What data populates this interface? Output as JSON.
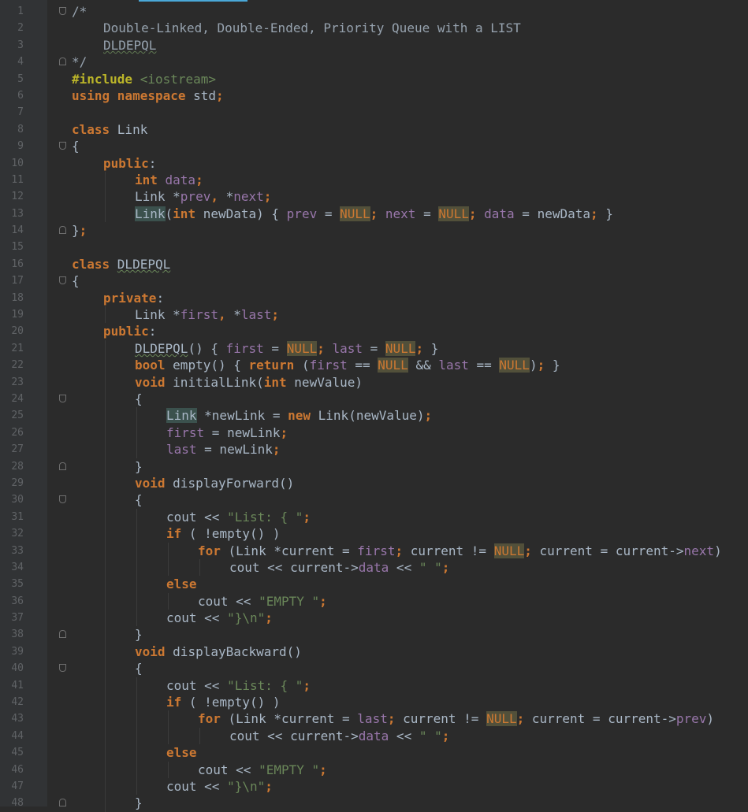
{
  "lines": [
    {
      "n": "1",
      "fold": "open",
      "indent": 0,
      "t": [
        {
          "c": "cm",
          "v": "/*"
        }
      ]
    },
    {
      "n": "2",
      "indent": 1,
      "t": [
        {
          "c": "cm",
          "v": "Double-Linked, Double-Ended, Priority Queue with a LIST"
        }
      ]
    },
    {
      "n": "3",
      "indent": 1,
      "t": [
        {
          "c": "cm squig",
          "v": "DLDEPQL"
        }
      ]
    },
    {
      "n": "4",
      "fold": "close",
      "indent": 0,
      "t": [
        {
          "c": "cm",
          "v": "*/"
        }
      ]
    },
    {
      "n": "5",
      "indent": 0,
      "t": [
        {
          "c": "pp kw",
          "v": "#include "
        },
        {
          "c": "str",
          "v": "<iostream>"
        }
      ]
    },
    {
      "n": "6",
      "indent": 0,
      "t": [
        {
          "c": "kw",
          "v": "using namespace "
        },
        {
          "c": "plain",
          "v": "std"
        },
        {
          "c": "kw",
          "v": ";"
        }
      ]
    },
    {
      "n": "7",
      "indent": 0,
      "t": []
    },
    {
      "n": "8",
      "indent": 0,
      "t": [
        {
          "c": "kw",
          "v": "class "
        },
        {
          "c": "plain",
          "v": "Link"
        }
      ]
    },
    {
      "n": "9",
      "fold": "open",
      "indent": 0,
      "t": [
        {
          "c": "plain",
          "v": "{"
        }
      ]
    },
    {
      "n": "10",
      "indent": 1,
      "t": [
        {
          "c": "kw",
          "v": "public"
        },
        {
          "c": "plain",
          "v": ":"
        }
      ]
    },
    {
      "n": "11",
      "indent": 2,
      "t": [
        {
          "c": "kw",
          "v": "int "
        },
        {
          "c": "fld",
          "v": "data"
        },
        {
          "c": "kw",
          "v": ";"
        }
      ]
    },
    {
      "n": "12",
      "indent": 2,
      "t": [
        {
          "c": "plain",
          "v": "Link *"
        },
        {
          "c": "fld",
          "v": "prev"
        },
        {
          "c": "kw",
          "v": ", "
        },
        {
          "c": "plain",
          "v": "*"
        },
        {
          "c": "fld",
          "v": "next"
        },
        {
          "c": "kw",
          "v": ";"
        }
      ]
    },
    {
      "n": "13",
      "indent": 2,
      "t": [
        {
          "c": "plain hl",
          "v": "Link"
        },
        {
          "c": "plain",
          "v": "("
        },
        {
          "c": "kw",
          "v": "int "
        },
        {
          "c": "plain",
          "v": "newData) { "
        },
        {
          "c": "fld",
          "v": "prev"
        },
        {
          "c": "plain",
          "v": " = "
        },
        {
          "c": "nul",
          "v": "NULL"
        },
        {
          "c": "kw",
          "v": "; "
        },
        {
          "c": "fld",
          "v": "next"
        },
        {
          "c": "plain",
          "v": " = "
        },
        {
          "c": "nul",
          "v": "NULL"
        },
        {
          "c": "kw",
          "v": "; "
        },
        {
          "c": "fld",
          "v": "data"
        },
        {
          "c": "plain",
          "v": " = newData"
        },
        {
          "c": "kw",
          "v": "; "
        },
        {
          "c": "plain",
          "v": "}"
        }
      ]
    },
    {
      "n": "14",
      "fold": "close",
      "indent": 0,
      "t": [
        {
          "c": "plain",
          "v": "}"
        },
        {
          "c": "kw",
          "v": ";"
        }
      ]
    },
    {
      "n": "15",
      "indent": 0,
      "t": []
    },
    {
      "n": "16",
      "indent": 0,
      "t": [
        {
          "c": "kw",
          "v": "class "
        },
        {
          "c": "plain squig",
          "v": "DLDEPQL"
        }
      ]
    },
    {
      "n": "17",
      "fold": "open",
      "indent": 0,
      "t": [
        {
          "c": "plain",
          "v": "{"
        }
      ]
    },
    {
      "n": "18",
      "indent": 1,
      "t": [
        {
          "c": "kw",
          "v": "private"
        },
        {
          "c": "plain",
          "v": ":"
        }
      ]
    },
    {
      "n": "19",
      "indent": 2,
      "t": [
        {
          "c": "plain",
          "v": "Link *"
        },
        {
          "c": "fld",
          "v": "first"
        },
        {
          "c": "kw",
          "v": ", "
        },
        {
          "c": "plain",
          "v": "*"
        },
        {
          "c": "fld",
          "v": "last"
        },
        {
          "c": "kw",
          "v": ";"
        }
      ]
    },
    {
      "n": "20",
      "indent": 1,
      "t": [
        {
          "c": "kw",
          "v": "public"
        },
        {
          "c": "plain",
          "v": ":"
        }
      ]
    },
    {
      "n": "21",
      "indent": 2,
      "t": [
        {
          "c": "plain squig",
          "v": "DLDEPQL"
        },
        {
          "c": "plain",
          "v": "() { "
        },
        {
          "c": "fld",
          "v": "first"
        },
        {
          "c": "plain",
          "v": " = "
        },
        {
          "c": "nul",
          "v": "NULL"
        },
        {
          "c": "kw",
          "v": "; "
        },
        {
          "c": "fld",
          "v": "last"
        },
        {
          "c": "plain",
          "v": " = "
        },
        {
          "c": "nul",
          "v": "NULL"
        },
        {
          "c": "kw",
          "v": "; "
        },
        {
          "c": "plain",
          "v": "}"
        }
      ]
    },
    {
      "n": "22",
      "indent": 2,
      "t": [
        {
          "c": "kw",
          "v": "bool "
        },
        {
          "c": "plain",
          "v": "empty() { "
        },
        {
          "c": "kw",
          "v": "return "
        },
        {
          "c": "plain",
          "v": "("
        },
        {
          "c": "fld",
          "v": "first"
        },
        {
          "c": "plain",
          "v": " == "
        },
        {
          "c": "nul",
          "v": "NULL"
        },
        {
          "c": "plain",
          "v": " && "
        },
        {
          "c": "fld",
          "v": "last"
        },
        {
          "c": "plain",
          "v": " == "
        },
        {
          "c": "nul",
          "v": "NULL"
        },
        {
          "c": "plain",
          "v": ")"
        },
        {
          "c": "kw",
          "v": "; "
        },
        {
          "c": "plain",
          "v": "}"
        }
      ]
    },
    {
      "n": "23",
      "indent": 2,
      "t": [
        {
          "c": "kw",
          "v": "void "
        },
        {
          "c": "plain",
          "v": "initialLink("
        },
        {
          "c": "kw",
          "v": "int "
        },
        {
          "c": "plain",
          "v": "newValue)"
        }
      ]
    },
    {
      "n": "24",
      "fold": "open",
      "indent": 2,
      "t": [
        {
          "c": "plain",
          "v": "{"
        }
      ]
    },
    {
      "n": "25",
      "indent": 3,
      "t": [
        {
          "c": "plain hl",
          "v": "Link"
        },
        {
          "c": "plain",
          "v": " *newLink = "
        },
        {
          "c": "kw",
          "v": "new "
        },
        {
          "c": "plain",
          "v": "Link(newValue)"
        },
        {
          "c": "kw",
          "v": ";"
        }
      ]
    },
    {
      "n": "26",
      "indent": 3,
      "t": [
        {
          "c": "fld",
          "v": "first"
        },
        {
          "c": "plain",
          "v": " = newLink"
        },
        {
          "c": "kw",
          "v": ";"
        }
      ]
    },
    {
      "n": "27",
      "indent": 3,
      "t": [
        {
          "c": "fld",
          "v": "last"
        },
        {
          "c": "plain",
          "v": " = newLink"
        },
        {
          "c": "kw",
          "v": ";"
        }
      ]
    },
    {
      "n": "28",
      "fold": "close",
      "indent": 2,
      "t": [
        {
          "c": "plain",
          "v": "}"
        }
      ]
    },
    {
      "n": "29",
      "indent": 2,
      "t": [
        {
          "c": "kw",
          "v": "void "
        },
        {
          "c": "plain",
          "v": "displayForward()"
        }
      ]
    },
    {
      "n": "30",
      "fold": "open",
      "indent": 2,
      "t": [
        {
          "c": "plain",
          "v": "{"
        }
      ]
    },
    {
      "n": "31",
      "indent": 3,
      "t": [
        {
          "c": "plain",
          "v": "cout << "
        },
        {
          "c": "str",
          "v": "\"List: { \""
        },
        {
          "c": "kw",
          "v": ";"
        }
      ]
    },
    {
      "n": "32",
      "indent": 3,
      "t": [
        {
          "c": "kw",
          "v": "if "
        },
        {
          "c": "plain",
          "v": "( !empty() )"
        }
      ]
    },
    {
      "n": "33",
      "indent": 4,
      "t": [
        {
          "c": "kw",
          "v": "for "
        },
        {
          "c": "plain",
          "v": "(Link *current = "
        },
        {
          "c": "fld",
          "v": "first"
        },
        {
          "c": "kw",
          "v": "; "
        },
        {
          "c": "plain",
          "v": "current != "
        },
        {
          "c": "nul",
          "v": "NULL"
        },
        {
          "c": "kw",
          "v": "; "
        },
        {
          "c": "plain",
          "v": "current = current->"
        },
        {
          "c": "fld",
          "v": "next"
        },
        {
          "c": "plain",
          "v": ")"
        }
      ]
    },
    {
      "n": "34",
      "indent": 5,
      "t": [
        {
          "c": "plain",
          "v": "cout << current->"
        },
        {
          "c": "fld",
          "v": "data"
        },
        {
          "c": "plain",
          "v": " << "
        },
        {
          "c": "str",
          "v": "\" \""
        },
        {
          "c": "kw",
          "v": ";"
        }
      ]
    },
    {
      "n": "35",
      "indent": 3,
      "t": [
        {
          "c": "kw",
          "v": "else"
        }
      ]
    },
    {
      "n": "36",
      "indent": 4,
      "t": [
        {
          "c": "plain",
          "v": "cout << "
        },
        {
          "c": "str",
          "v": "\"EMPTY \""
        },
        {
          "c": "kw",
          "v": ";"
        }
      ]
    },
    {
      "n": "37",
      "indent": 3,
      "t": [
        {
          "c": "plain",
          "v": "cout << "
        },
        {
          "c": "str",
          "v": "\"}\\n\""
        },
        {
          "c": "kw",
          "v": ";"
        }
      ]
    },
    {
      "n": "38",
      "fold": "close",
      "indent": 2,
      "t": [
        {
          "c": "plain",
          "v": "}"
        }
      ]
    },
    {
      "n": "39",
      "indent": 2,
      "t": [
        {
          "c": "kw",
          "v": "void "
        },
        {
          "c": "plain",
          "v": "displayBackward()"
        }
      ]
    },
    {
      "n": "40",
      "fold": "open",
      "indent": 2,
      "t": [
        {
          "c": "plain",
          "v": "{"
        }
      ]
    },
    {
      "n": "41",
      "indent": 3,
      "t": [
        {
          "c": "plain",
          "v": "cout << "
        },
        {
          "c": "str",
          "v": "\"List: { \""
        },
        {
          "c": "kw",
          "v": ";"
        }
      ]
    },
    {
      "n": "42",
      "indent": 3,
      "t": [
        {
          "c": "kw",
          "v": "if "
        },
        {
          "c": "plain",
          "v": "( !empty() )"
        }
      ]
    },
    {
      "n": "43",
      "indent": 4,
      "t": [
        {
          "c": "kw",
          "v": "for "
        },
        {
          "c": "plain",
          "v": "(Link *current = "
        },
        {
          "c": "fld",
          "v": "last"
        },
        {
          "c": "kw",
          "v": "; "
        },
        {
          "c": "plain",
          "v": "current != "
        },
        {
          "c": "nul",
          "v": "NULL"
        },
        {
          "c": "kw",
          "v": "; "
        },
        {
          "c": "plain",
          "v": "current = current->"
        },
        {
          "c": "fld",
          "v": "prev"
        },
        {
          "c": "plain",
          "v": ")"
        }
      ]
    },
    {
      "n": "44",
      "indent": 5,
      "t": [
        {
          "c": "plain",
          "v": "cout << current->"
        },
        {
          "c": "fld",
          "v": "data"
        },
        {
          "c": "plain",
          "v": " << "
        },
        {
          "c": "str",
          "v": "\" \""
        },
        {
          "c": "kw",
          "v": ";"
        }
      ]
    },
    {
      "n": "45",
      "indent": 3,
      "t": [
        {
          "c": "kw",
          "v": "else"
        }
      ]
    },
    {
      "n": "46",
      "indent": 4,
      "t": [
        {
          "c": "plain",
          "v": "cout << "
        },
        {
          "c": "str",
          "v": "\"EMPTY \""
        },
        {
          "c": "kw",
          "v": ";"
        }
      ]
    },
    {
      "n": "47",
      "indent": 3,
      "t": [
        {
          "c": "plain",
          "v": "cout << "
        },
        {
          "c": "str",
          "v": "\"}\\n\""
        },
        {
          "c": "kw",
          "v": ";"
        }
      ]
    },
    {
      "n": "48",
      "fold": "close",
      "indent": 2,
      "t": [
        {
          "c": "plain",
          "v": "}"
        }
      ]
    }
  ]
}
